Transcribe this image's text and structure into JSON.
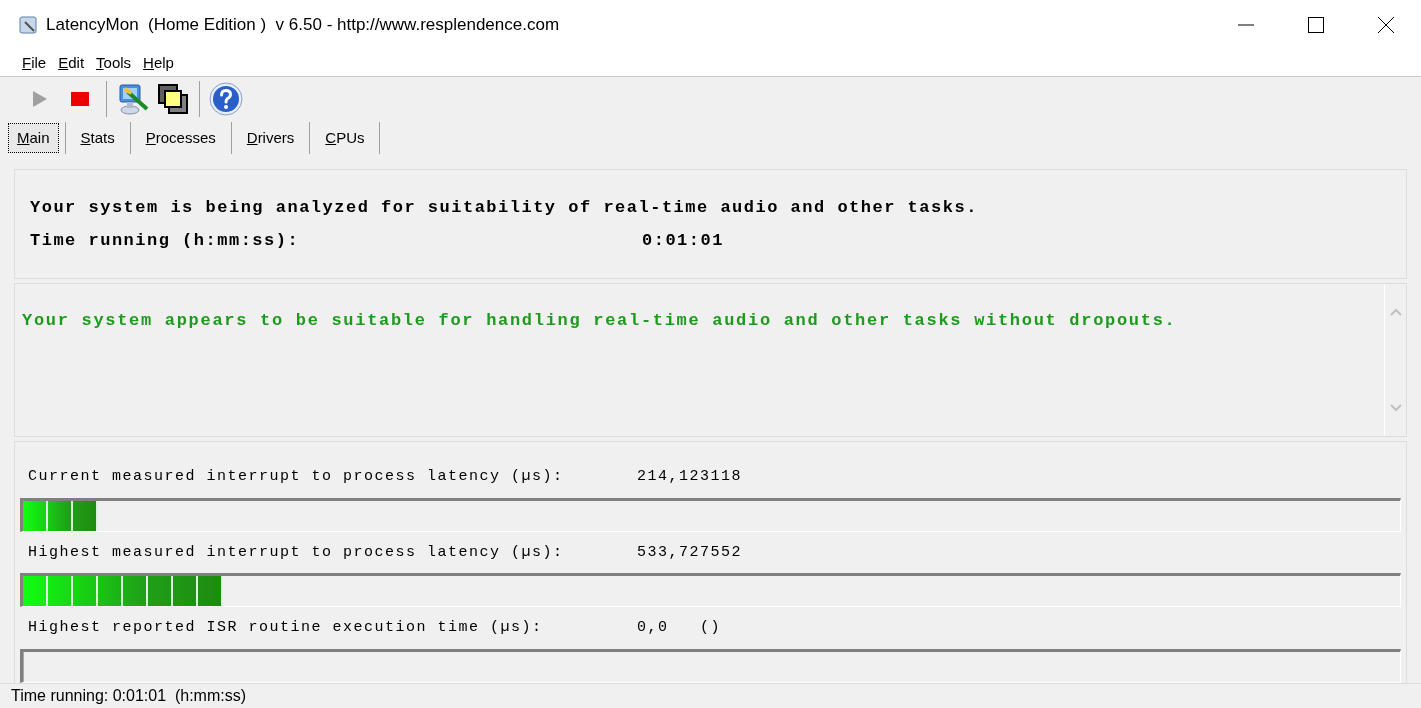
{
  "window": {
    "title": "LatencyMon  (Home Edition )  v 6.50 - http://www.resplendence.com"
  },
  "menu": [
    "File",
    "Edit",
    "Tools",
    "Help"
  ],
  "toolbar": [
    {
      "kind": "play"
    },
    {
      "kind": "stop"
    },
    {
      "kind": "separator"
    },
    {
      "kind": "monitor"
    },
    {
      "kind": "windows"
    },
    {
      "kind": "separator"
    },
    {
      "kind": "help"
    }
  ],
  "tabs": [
    {
      "label": "Main",
      "selected": true
    },
    {
      "label": "Stats",
      "selected": false
    },
    {
      "label": "Processes",
      "selected": false
    },
    {
      "label": "Drivers",
      "selected": false
    },
    {
      "label": "CPUs",
      "selected": false
    }
  ],
  "status": {
    "analysis": "Your system is being analyzed for suitability of real-time audio and other tasks.",
    "time_label": "Time running (h:mm:ss):",
    "time_value": "0:01:01"
  },
  "verdict": "Your system appears to be suitable for handling real-time audio and other tasks without dropouts.",
  "meters": [
    {
      "label": "Current measured interrupt to process latency (µs):",
      "value": "214,123118",
      "level": 0.0545
    },
    {
      "label": "Highest measured interrupt to process latency (µs):",
      "value": "533,727552",
      "level": 0.1455
    },
    {
      "label": "Highest reported ISR routine execution time (µs):",
      "value": "0,0   ()",
      "level": 0
    }
  ],
  "status_bar": "Time running: 0:01:01  (h:mm:ss)"
}
